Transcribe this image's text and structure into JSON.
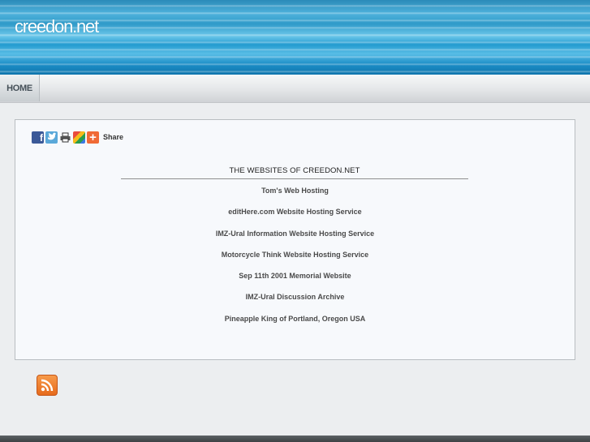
{
  "header": {
    "site_title": "creedon.net"
  },
  "nav": {
    "items": [
      {
        "label": "HOME"
      }
    ]
  },
  "share": {
    "icons": [
      "facebook-icon",
      "twitter-icon",
      "print-icon",
      "google-icon",
      "addthis-plus-icon"
    ],
    "label": "Share"
  },
  "main": {
    "heading": "THE WEBSITES OF CREEDON.NET",
    "links": [
      "Tom's Web Hosting",
      "editHere.com Website Hosting Service",
      "IMZ-Ural Information Website Hosting Service",
      "Motorcycle Think Website Hosting Service",
      "Sep 11th 2001 Memorial Website",
      "IMZ-Ural Discussion Archive",
      "Pineapple King of Portland, Oregon USA"
    ]
  },
  "footer": {
    "rss_icon": "rss-icon"
  }
}
